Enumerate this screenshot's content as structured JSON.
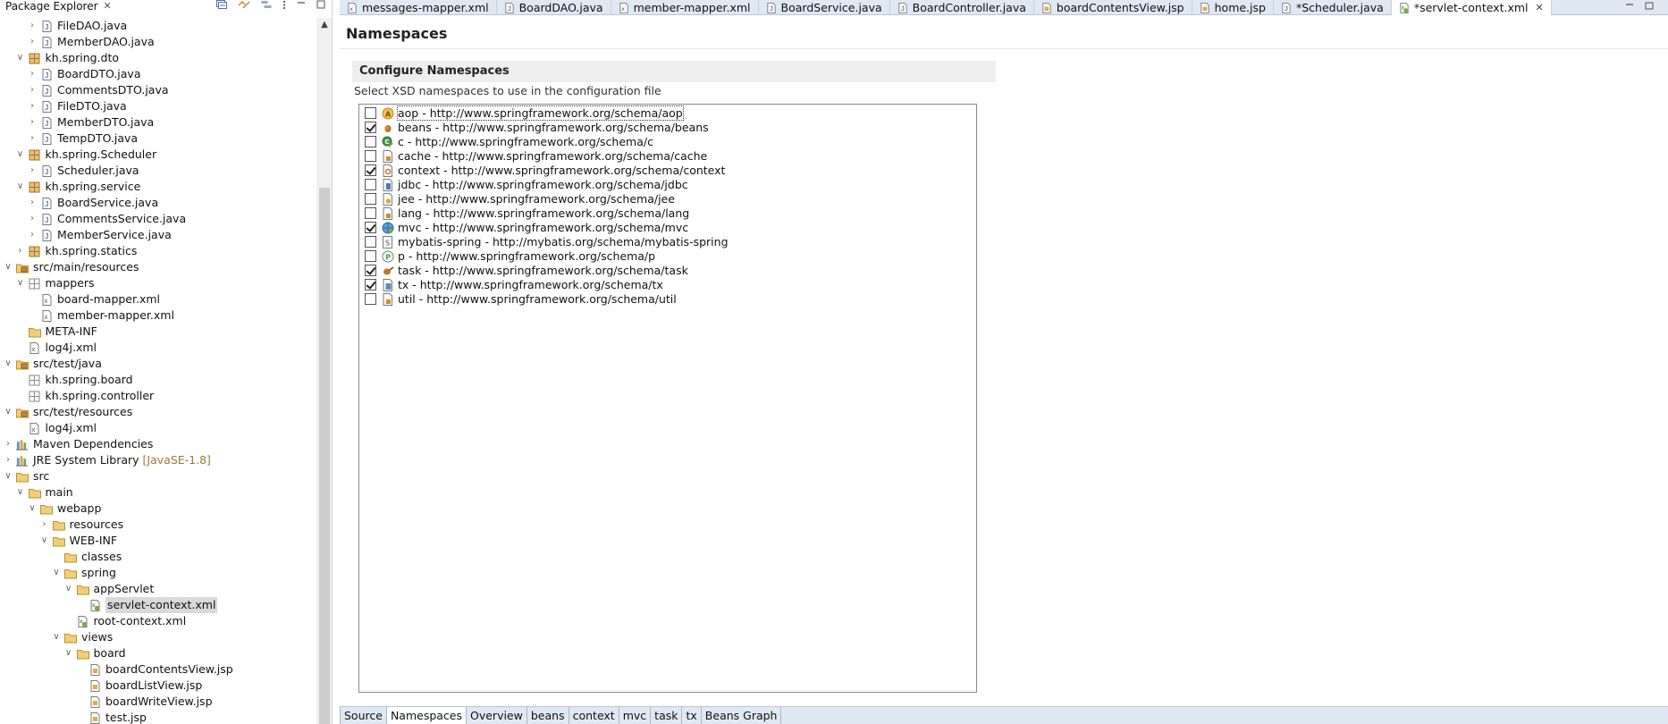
{
  "explorer": {
    "title": "Package Explorer",
    "close_label": "✕",
    "tree": [
      {
        "label": "FileDAO.java",
        "indent": 2,
        "twisty": ">",
        "icon": "java-icon"
      },
      {
        "label": "MemberDAO.java",
        "indent": 2,
        "twisty": ">",
        "icon": "java-icon"
      },
      {
        "label": "kh.spring.dto",
        "indent": 1,
        "twisty": "v",
        "icon": "package-icon"
      },
      {
        "label": "BoardDTO.java",
        "indent": 2,
        "twisty": ">",
        "icon": "java-icon"
      },
      {
        "label": "CommentsDTO.java",
        "indent": 2,
        "twisty": ">",
        "icon": "java-icon"
      },
      {
        "label": "FileDTO.java",
        "indent": 2,
        "twisty": ">",
        "icon": "java-icon"
      },
      {
        "label": "MemberDTO.java",
        "indent": 2,
        "twisty": ">",
        "icon": "java-icon"
      },
      {
        "label": "TempDTO.java",
        "indent": 2,
        "twisty": ">",
        "icon": "java-icon"
      },
      {
        "label": "kh.spring.Scheduler",
        "indent": 1,
        "twisty": "v",
        "icon": "package-icon"
      },
      {
        "label": "Scheduler.java",
        "indent": 2,
        "twisty": ">",
        "icon": "java-icon"
      },
      {
        "label": "kh.spring.service",
        "indent": 1,
        "twisty": "v",
        "icon": "package-icon"
      },
      {
        "label": "BoardService.java",
        "indent": 2,
        "twisty": ">",
        "icon": "java-icon"
      },
      {
        "label": "CommentsService.java",
        "indent": 2,
        "twisty": ">",
        "icon": "java-icon"
      },
      {
        "label": "MemberService.java",
        "indent": 2,
        "twisty": ">",
        "icon": "java-icon"
      },
      {
        "label": "kh.spring.statics",
        "indent": 1,
        "twisty": ">",
        "icon": "package-icon"
      },
      {
        "label": "src/main/resources",
        "indent": 0,
        "twisty": "v",
        "icon": "source-folder-icon"
      },
      {
        "label": "mappers",
        "indent": 1,
        "twisty": "v",
        "icon": "package-empty-icon"
      },
      {
        "label": "board-mapper.xml",
        "indent": 2,
        "twisty": "",
        "icon": "xml-icon"
      },
      {
        "label": "member-mapper.xml",
        "indent": 2,
        "twisty": "",
        "icon": "xml-icon"
      },
      {
        "label": "META-INF",
        "indent": 1,
        "twisty": "",
        "icon": "folder-icon"
      },
      {
        "label": "log4j.xml",
        "indent": 1,
        "twisty": "",
        "icon": "xml-icon"
      },
      {
        "label": "src/test/java",
        "indent": 0,
        "twisty": "v",
        "icon": "source-folder-icon"
      },
      {
        "label": "kh.spring.board",
        "indent": 1,
        "twisty": "",
        "icon": "package-empty-icon"
      },
      {
        "label": "kh.spring.controller",
        "indent": 1,
        "twisty": "",
        "icon": "package-empty-icon"
      },
      {
        "label": "src/test/resources",
        "indent": 0,
        "twisty": "v",
        "icon": "source-folder-icon"
      },
      {
        "label": "log4j.xml",
        "indent": 1,
        "twisty": "",
        "icon": "xml-icon"
      },
      {
        "label": "Maven Dependencies",
        "indent": 0,
        "twisty": ">",
        "icon": "library-icon"
      },
      {
        "label": "JRE System Library",
        "decoration": "[JavaSE-1.8]",
        "indent": 0,
        "twisty": ">",
        "icon": "library-icon"
      },
      {
        "label": "src",
        "indent": 0,
        "twisty": "v",
        "icon": "folder-icon"
      },
      {
        "label": "main",
        "indent": 1,
        "twisty": "v",
        "icon": "folder-icon"
      },
      {
        "label": "webapp",
        "indent": 2,
        "twisty": "v",
        "icon": "folder-icon"
      },
      {
        "label": "resources",
        "indent": 3,
        "twisty": ">",
        "icon": "folder-icon"
      },
      {
        "label": "WEB-INF",
        "indent": 3,
        "twisty": "v",
        "icon": "folder-icon"
      },
      {
        "label": "classes",
        "indent": 4,
        "twisty": "",
        "icon": "folder-icon"
      },
      {
        "label": "spring",
        "indent": 4,
        "twisty": "v",
        "icon": "folder-icon"
      },
      {
        "label": "appServlet",
        "indent": 5,
        "twisty": "v",
        "icon": "folder-icon"
      },
      {
        "label": "servlet-context.xml",
        "indent": 6,
        "twisty": "",
        "icon": "spring-xml-icon",
        "selected": true
      },
      {
        "label": "root-context.xml",
        "indent": 5,
        "twisty": "",
        "icon": "spring-xml-icon"
      },
      {
        "label": "views",
        "indent": 4,
        "twisty": "v",
        "icon": "folder-icon"
      },
      {
        "label": "board",
        "indent": 5,
        "twisty": "v",
        "icon": "folder-icon"
      },
      {
        "label": "boardContentsView.jsp",
        "indent": 6,
        "twisty": "",
        "icon": "jsp-icon"
      },
      {
        "label": "boardListView.jsp",
        "indent": 6,
        "twisty": "",
        "icon": "jsp-icon"
      },
      {
        "label": "boardWriteView.jsp",
        "indent": 6,
        "twisty": "",
        "icon": "jsp-icon"
      },
      {
        "label": "test.jsp",
        "indent": 6,
        "twisty": "",
        "icon": "jsp-icon"
      }
    ]
  },
  "editor": {
    "tabs": [
      {
        "label": "messages-mapper.xml",
        "icon": "xml-icon"
      },
      {
        "label": "BoardDAO.java",
        "icon": "java-icon"
      },
      {
        "label": "member-mapper.xml",
        "icon": "xml-icon"
      },
      {
        "label": "BoardService.java",
        "icon": "java-icon"
      },
      {
        "label": "BoardController.java",
        "icon": "java-icon"
      },
      {
        "label": "boardContentsView.jsp",
        "icon": "jsp-icon"
      },
      {
        "label": "home.jsp",
        "icon": "jsp-icon"
      },
      {
        "label": "*Scheduler.java",
        "icon": "java-icon"
      },
      {
        "label": "*servlet-context.xml",
        "icon": "spring-xml-icon",
        "active": true,
        "close": "✕"
      }
    ],
    "page_title": "Namespaces",
    "section_title": "Configure Namespaces",
    "section_description": "Select XSD namespaces to use in the configuration file",
    "namespaces": [
      {
        "text": "aop - http://www.springframework.org/schema/aop",
        "checked": false,
        "icon": "aop-icon",
        "focused": true
      },
      {
        "text": "beans - http://www.springframework.org/schema/beans",
        "checked": true,
        "icon": "beans-icon"
      },
      {
        "text": "c - http://www.springframework.org/schema/c",
        "checked": false,
        "icon": "c-icon"
      },
      {
        "text": "cache - http://www.springframework.org/schema/cache",
        "checked": false,
        "icon": "cache-icon"
      },
      {
        "text": "context - http://www.springframework.org/schema/context",
        "checked": true,
        "icon": "context-icon"
      },
      {
        "text": "jdbc - http://www.springframework.org/schema/jdbc",
        "checked": false,
        "icon": "jdbc-icon"
      },
      {
        "text": "jee - http://www.springframework.org/schema/jee",
        "checked": false,
        "icon": "jee-icon"
      },
      {
        "text": "lang - http://www.springframework.org/schema/lang",
        "checked": false,
        "icon": "lang-icon"
      },
      {
        "text": "mvc - http://www.springframework.org/schema/mvc",
        "checked": true,
        "icon": "mvc-icon"
      },
      {
        "text": "mybatis-spring - http://mybatis.org/schema/mybatis-spring",
        "checked": false,
        "icon": "mybatis-icon"
      },
      {
        "text": "p - http://www.springframework.org/schema/p",
        "checked": false,
        "icon": "p-icon"
      },
      {
        "text": "task - http://www.springframework.org/schema/task",
        "checked": true,
        "icon": "task-icon"
      },
      {
        "text": "tx - http://www.springframework.org/schema/tx",
        "checked": true,
        "icon": "tx-icon"
      },
      {
        "text": "util - http://www.springframework.org/schema/util",
        "checked": false,
        "icon": "util-icon"
      }
    ],
    "bottom_tabs": [
      {
        "label": "Source"
      },
      {
        "label": "Namespaces",
        "active": true
      },
      {
        "label": "Overview"
      },
      {
        "label": "beans"
      },
      {
        "label": "context"
      },
      {
        "label": "mvc"
      },
      {
        "label": "task"
      },
      {
        "label": "tx"
      },
      {
        "label": "Beans Graph"
      }
    ]
  },
  "colors": {
    "tab_bar": "#dfe8f3",
    "selection": "#d9d9d9",
    "folder": "#e6b85c",
    "package": "#c8893a",
    "java": "#5b7fb5",
    "spring": "#6db33f"
  }
}
